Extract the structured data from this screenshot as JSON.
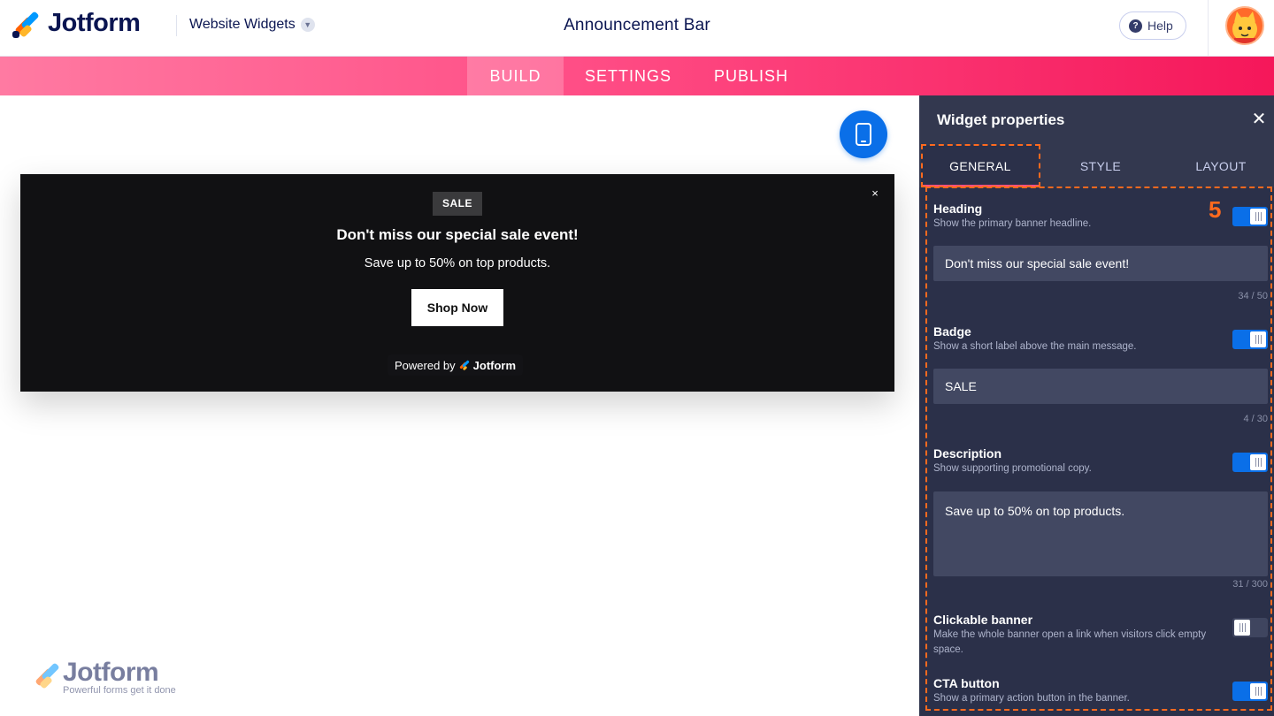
{
  "header": {
    "brand": "Jotform",
    "product_switch": "Website Widgets",
    "page_title": "Announcement Bar",
    "help_label": "Help"
  },
  "nav": {
    "tabs": [
      {
        "label": "BUILD",
        "active": true
      },
      {
        "label": "SETTINGS",
        "active": false
      },
      {
        "label": "PUBLISH",
        "active": false
      }
    ]
  },
  "preview": {
    "badge": "SALE",
    "heading": "Don't miss our special sale event!",
    "description": "Save up to 50% on top products.",
    "cta_label": "Shop Now",
    "powered_prefix": "Powered by",
    "powered_brand": "Jotform",
    "close_glyph": "×"
  },
  "watermark": {
    "brand": "Jotform",
    "tagline": "Powerful forms get it done"
  },
  "panel": {
    "title": "Widget properties",
    "close_glyph": "✕",
    "tabs": [
      {
        "label": "GENERAL",
        "active": true
      },
      {
        "label": "STYLE",
        "active": false
      },
      {
        "label": "LAYOUT",
        "active": false
      }
    ],
    "step_marker": "5",
    "properties": {
      "heading": {
        "label": "Heading",
        "help": "Show the primary banner headline.",
        "enabled": true,
        "value": "Don't miss our special sale event!",
        "counter": "34 / 50"
      },
      "badge": {
        "label": "Badge",
        "help": "Show a short label above the main message.",
        "enabled": true,
        "value": "SALE",
        "counter": "4 / 30"
      },
      "description": {
        "label": "Description",
        "help": "Show supporting promotional copy.",
        "enabled": true,
        "value": "Save up to 50% on top products.",
        "counter": "31 / 300"
      },
      "clickable_banner": {
        "label": "Clickable banner",
        "help": "Make the whole banner open a link when visitors click empty space.",
        "enabled": false
      },
      "cta_button": {
        "label": "CTA button",
        "help": "Show a primary action button in the banner.",
        "enabled": true
      }
    }
  },
  "colors": {
    "brand_navy": "#0a1551",
    "accent_pink": "#ff4e86",
    "toggle_blue": "#0a6fe8",
    "panel_bg": "#2b3049",
    "highlight_orange": "#ff6a1e"
  },
  "icons": {
    "device": "mobile-phone-icon",
    "help": "question-circle-icon",
    "chevron": "chevron-down-icon"
  }
}
